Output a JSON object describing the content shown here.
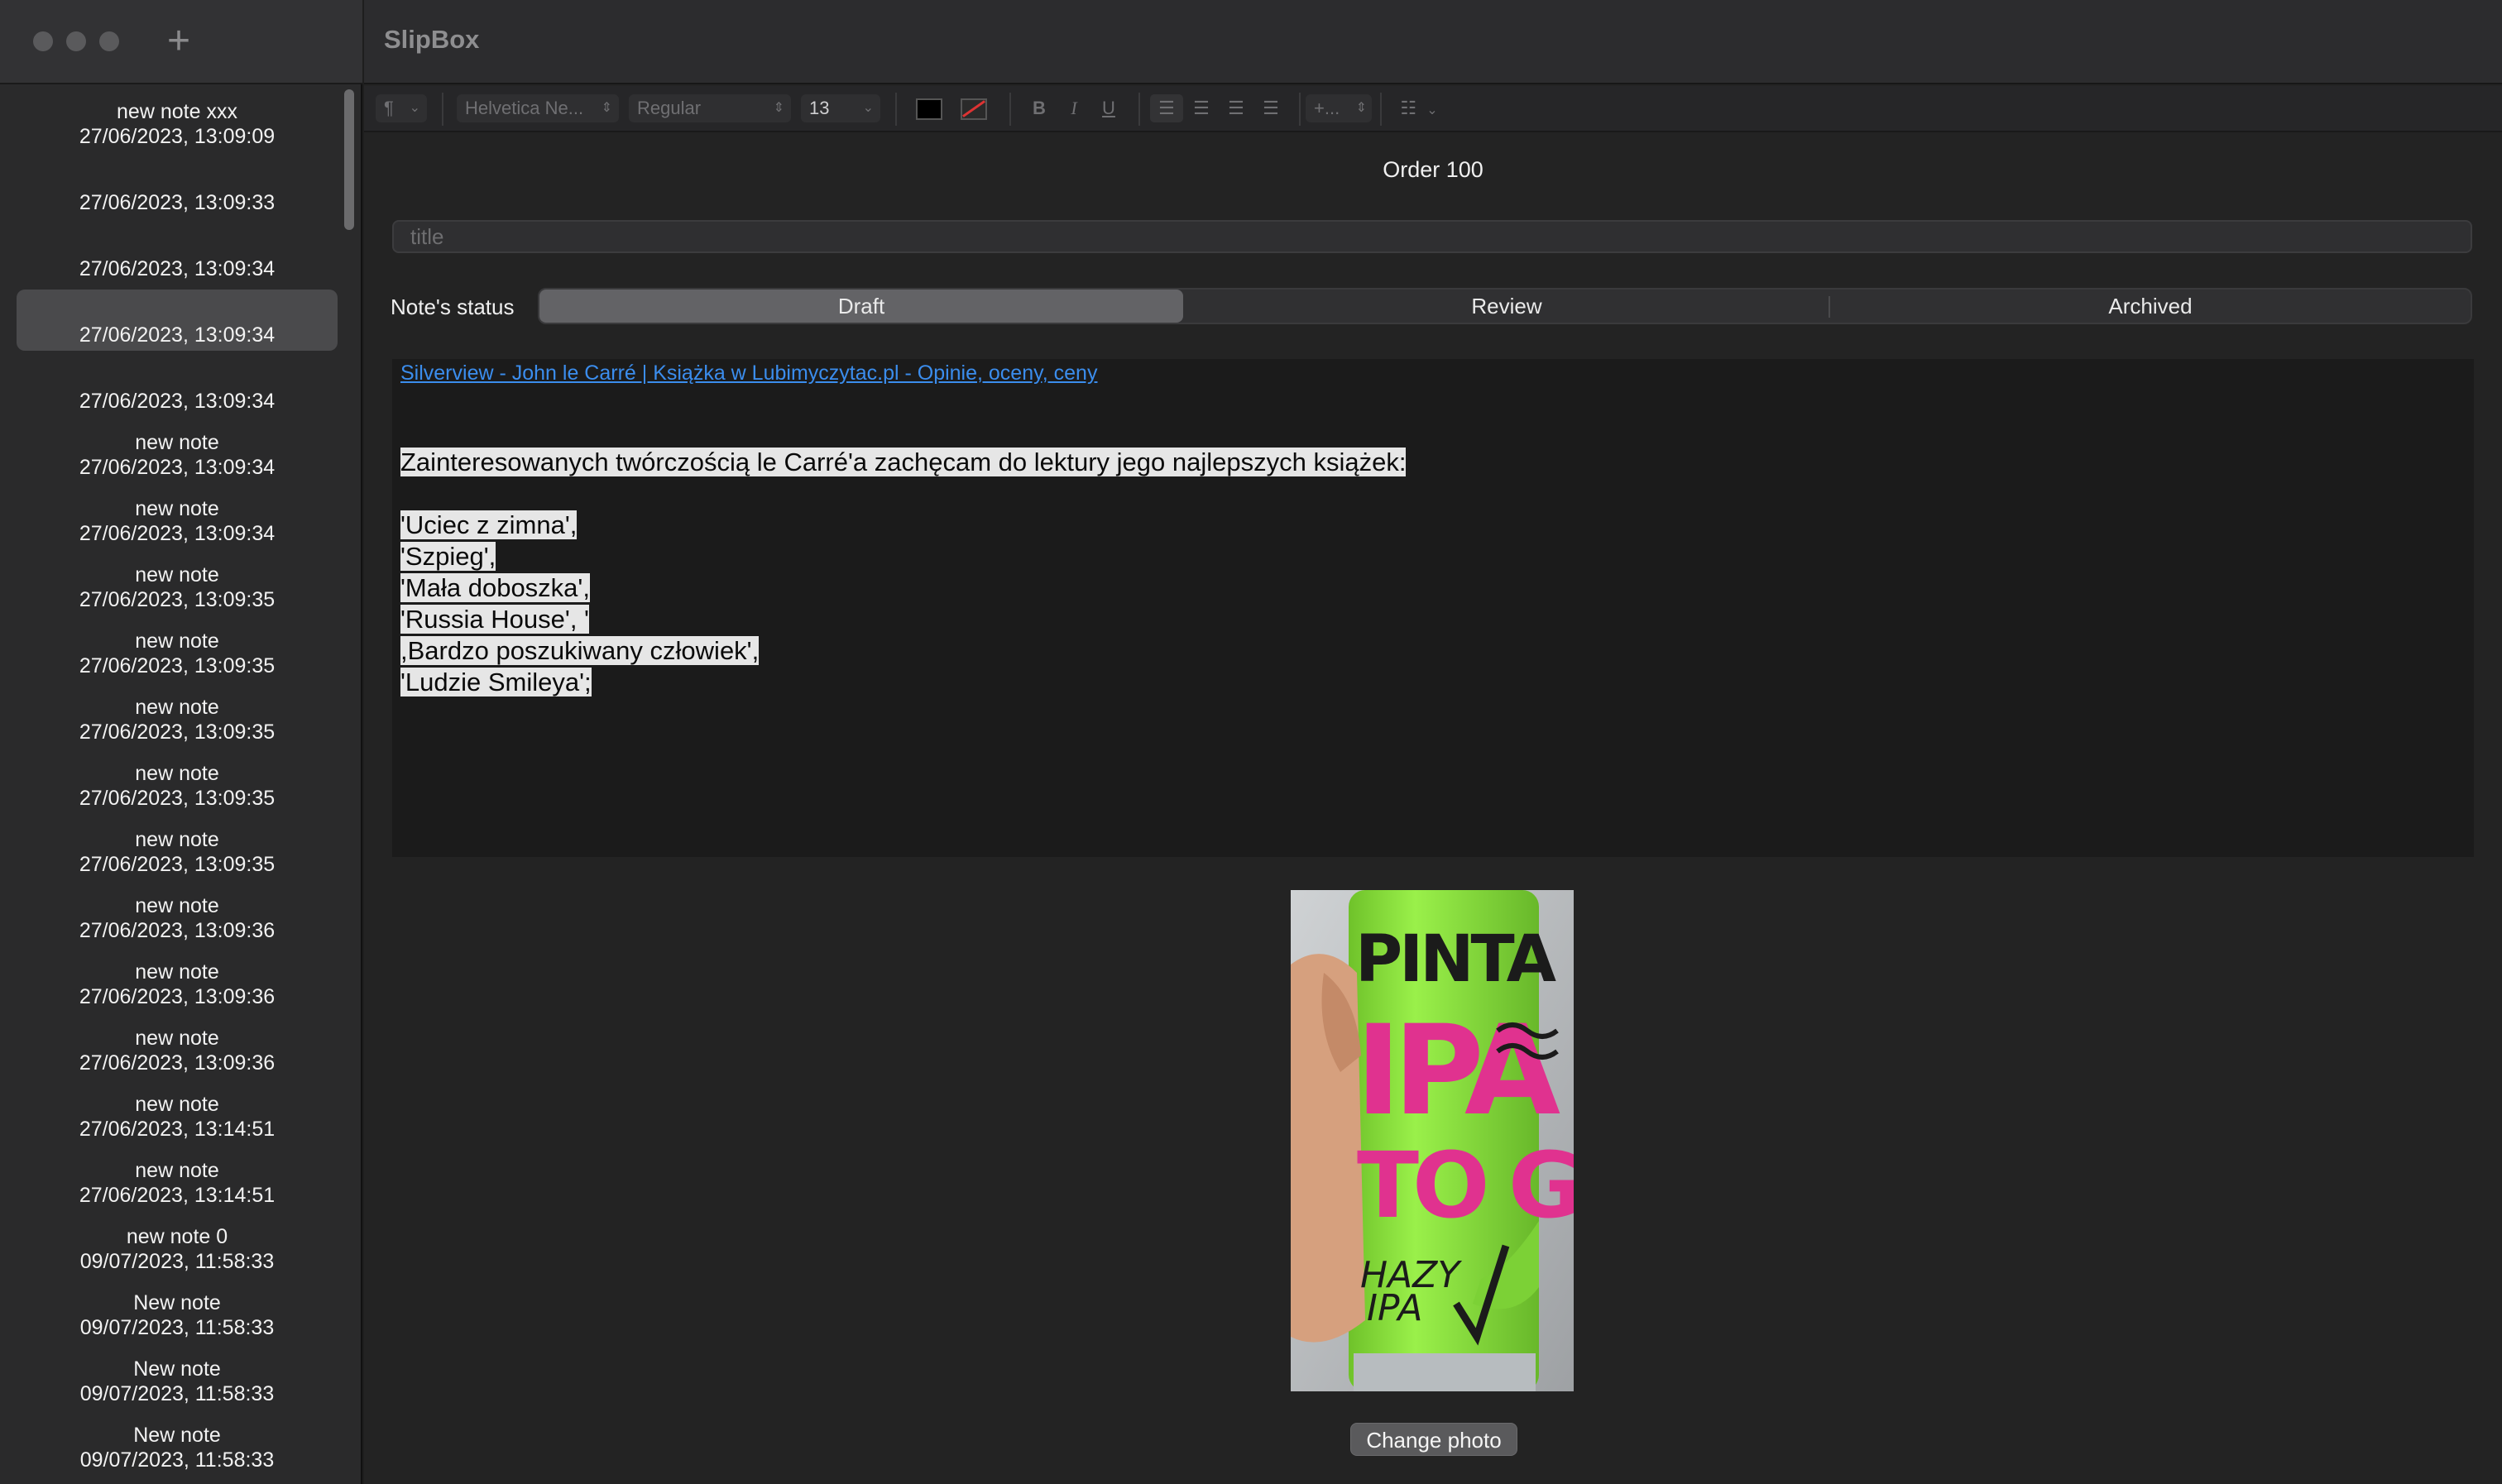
{
  "app": {
    "title": "SlipBox",
    "add_symbol": "+"
  },
  "sidebar": {
    "notes": [
      {
        "title": "new note xxx",
        "date": "27/06/2023, 13:09:09"
      },
      {
        "title": "",
        "date": "27/06/2023, 13:09:33"
      },
      {
        "title": "",
        "date": "27/06/2023, 13:09:34"
      },
      {
        "title": "",
        "date": "27/06/2023, 13:09:34",
        "selected": true
      },
      {
        "title": "",
        "date": "27/06/2023, 13:09:34"
      },
      {
        "title": "new note",
        "date": "27/06/2023, 13:09:34"
      },
      {
        "title": "new note",
        "date": "27/06/2023, 13:09:34"
      },
      {
        "title": "new note",
        "date": "27/06/2023, 13:09:35"
      },
      {
        "title": "new note",
        "date": "27/06/2023, 13:09:35"
      },
      {
        "title": "new note",
        "date": "27/06/2023, 13:09:35"
      },
      {
        "title": "new note",
        "date": "27/06/2023, 13:09:35"
      },
      {
        "title": "new note",
        "date": "27/06/2023, 13:09:35"
      },
      {
        "title": "new note",
        "date": "27/06/2023, 13:09:36"
      },
      {
        "title": "new note",
        "date": "27/06/2023, 13:09:36"
      },
      {
        "title": "new note",
        "date": "27/06/2023, 13:09:36"
      },
      {
        "title": "new note",
        "date": "27/06/2023, 13:14:51"
      },
      {
        "title": "new note",
        "date": "27/06/2023, 13:14:51"
      },
      {
        "title": "new note 0",
        "date": "09/07/2023, 11:58:33"
      },
      {
        "title": "New note",
        "date": "09/07/2023, 11:58:33"
      },
      {
        "title": "New note",
        "date": "09/07/2023, 11:58:33"
      },
      {
        "title": "New note",
        "date": "09/07/2023, 11:58:33"
      }
    ]
  },
  "toolbar": {
    "paragraph_style": "¶",
    "font_family": "Helvetica Ne...",
    "font_weight": "Regular",
    "font_size": "13",
    "bold": "B",
    "italic": "I",
    "underline": "U",
    "spacing": "+...",
    "text_color": "#000000"
  },
  "note": {
    "heading": "Order 100",
    "title_placeholder": "title",
    "title_value": "",
    "status_label": "Note's status",
    "status_options": [
      "Draft",
      "Review",
      "Archived"
    ],
    "status_selected": "Draft",
    "link_text": "Silverview - John le Carré | Książka w Lubimyczytac.pl - Opinie, oceny, ceny",
    "body_lines": [
      "Zainteresowanych twórczością le Carré'a zachęcam do lektury jego najlepszych książek:",
      "'Uciec z zimna',",
      "'Szpieg',",
      "'Mała doboszka',",
      "'Russia House', '",
      ",Bardzo poszukiwany człowiek',",
      "'Ludzie Smileya';"
    ],
    "change_photo_label": "Change photo"
  },
  "photo": {
    "brand": "PINTA",
    "name_line1": "IPA",
    "name_line2": "TO GO",
    "style": "HAZY IPA",
    "colors": {
      "can": "#8fe03a",
      "text": "#e0328f",
      "dark": "#1b1b1b"
    }
  },
  "colors": {
    "accent_link": "#3b8ded",
    "highlight": "#e6e6e6"
  }
}
